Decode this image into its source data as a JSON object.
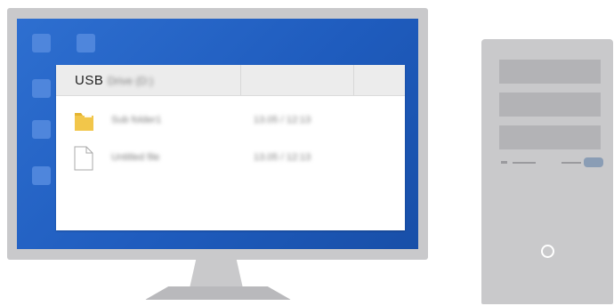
{
  "file_window": {
    "title": "USB",
    "title_suffix": "(blurred)",
    "rows": [
      {
        "icon": "folder-icon",
        "name": "(blurred name)",
        "date": "(blurred date)"
      },
      {
        "icon": "file-icon",
        "name": "(blurred name)",
        "date": "(blurred date)"
      }
    ]
  },
  "colors": {
    "desktop": "#2464c8",
    "frame": "#c9c9cb",
    "folder": "#f2c64a",
    "port_accent": "#8a9db5"
  }
}
